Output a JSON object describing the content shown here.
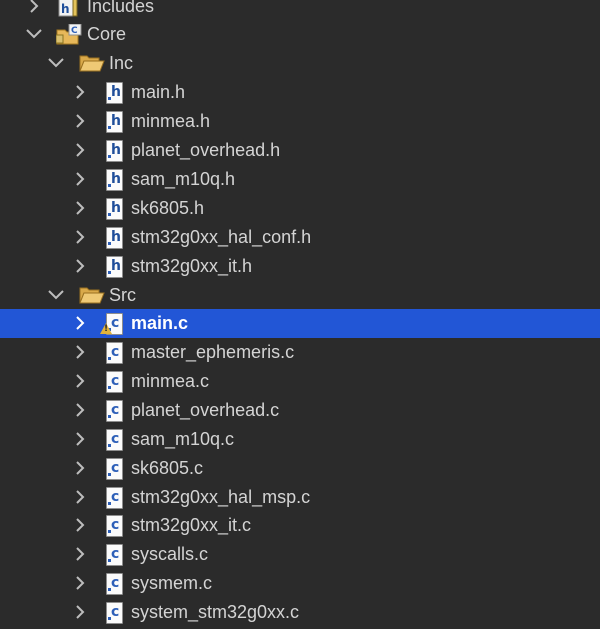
{
  "tree": {
    "includes": {
      "label": "Includes",
      "icon": "includes-library-icon"
    },
    "core": {
      "label": "Core",
      "icon": "project-folder-icon"
    },
    "inc": {
      "label": "Inc",
      "icon": "folder-open-icon",
      "files": [
        {
          "label": "main.h",
          "icon": "header-file-icon"
        },
        {
          "label": "minmea.h",
          "icon": "header-file-icon"
        },
        {
          "label": "planet_overhead.h",
          "icon": "header-file-icon"
        },
        {
          "label": "sam_m10q.h",
          "icon": "header-file-icon"
        },
        {
          "label": "sk6805.h",
          "icon": "header-file-icon"
        },
        {
          "label": "stm32g0xx_hal_conf.h",
          "icon": "header-file-icon"
        },
        {
          "label": "stm32g0xx_it.h",
          "icon": "header-file-icon"
        }
      ]
    },
    "src": {
      "label": "Src",
      "icon": "folder-open-icon",
      "files": [
        {
          "label": "main.c",
          "icon": "source-file-icon",
          "selected": true,
          "warning": true
        },
        {
          "label": "master_ephemeris.c",
          "icon": "source-file-icon"
        },
        {
          "label": "minmea.c",
          "icon": "source-file-icon"
        },
        {
          "label": "planet_overhead.c",
          "icon": "source-file-icon"
        },
        {
          "label": "sam_m10q.c",
          "icon": "source-file-icon"
        },
        {
          "label": "sk6805.c",
          "icon": "source-file-icon"
        },
        {
          "label": "stm32g0xx_hal_msp.c",
          "icon": "source-file-icon"
        },
        {
          "label": "stm32g0xx_it.c",
          "icon": "source-file-icon"
        },
        {
          "label": "syscalls.c",
          "icon": "source-file-icon"
        },
        {
          "label": "sysmem.c",
          "icon": "source-file-icon"
        },
        {
          "label": "system_stm32g0xx.c",
          "icon": "source-file-icon"
        }
      ]
    }
  },
  "colors": {
    "background": "#2b2b2b",
    "selection": "#2256d6",
    "text": "#d4d4d4",
    "selected_text": "#ffffff",
    "warning": "#e2b33a"
  }
}
